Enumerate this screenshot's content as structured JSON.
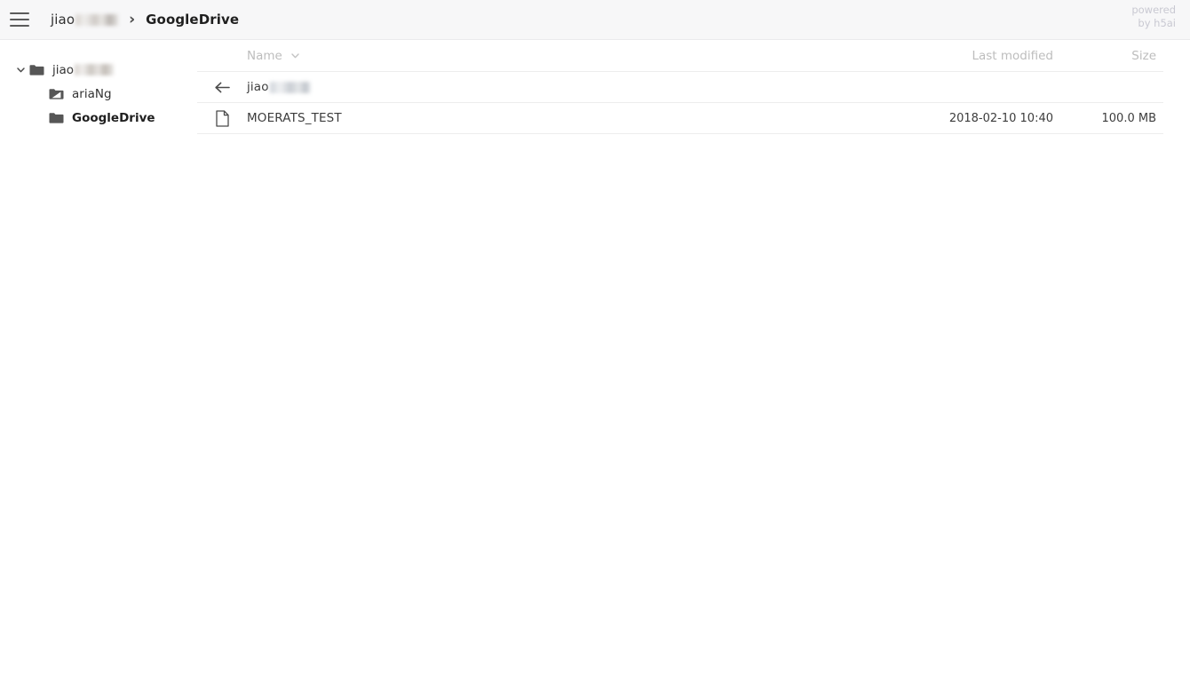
{
  "header": {
    "menu_icon": "hamburger-icon",
    "breadcrumbs": [
      {
        "label": "jiao",
        "redacted": true,
        "current": false
      },
      {
        "label": "GoogleDrive",
        "redacted": false,
        "current": true
      }
    ],
    "separator": "›",
    "powered_line1": "powered",
    "powered_line2": "by h5ai"
  },
  "sidebar": {
    "items": [
      {
        "label": "jiao",
        "redacted": true,
        "level": 0,
        "icon": "folder-icon",
        "expanded": true,
        "bold": false
      },
      {
        "label": "ariaNg",
        "redacted": false,
        "level": 1,
        "icon": "folder-link-icon",
        "expanded": false,
        "bold": false
      },
      {
        "label": "GoogleDrive",
        "redacted": false,
        "level": 1,
        "icon": "folder-icon",
        "expanded": false,
        "bold": true
      }
    ]
  },
  "table": {
    "columns": {
      "name": "Name",
      "last_modified": "Last modified",
      "size": "Size"
    },
    "sort": {
      "column": "Name",
      "direction": "desc",
      "caret": "chevron-down-icon"
    },
    "rows": [
      {
        "icon": "arrow-left-icon",
        "name": "jiao",
        "redacted": true,
        "last_modified": "",
        "size": "",
        "type": "parent"
      },
      {
        "icon": "file-icon",
        "name": "MOERATS_TEST",
        "redacted": false,
        "last_modified": "2018-02-10 10:40",
        "size": "100.0 MB",
        "type": "file"
      }
    ]
  },
  "colors": {
    "header_bg": "#f7f7f8",
    "page_bg": "#ffffff",
    "text": "#3a3a3a",
    "muted": "#bdbdbd",
    "icon": "#555555",
    "rule": "#ededed",
    "powered": "#c9c9d2"
  }
}
